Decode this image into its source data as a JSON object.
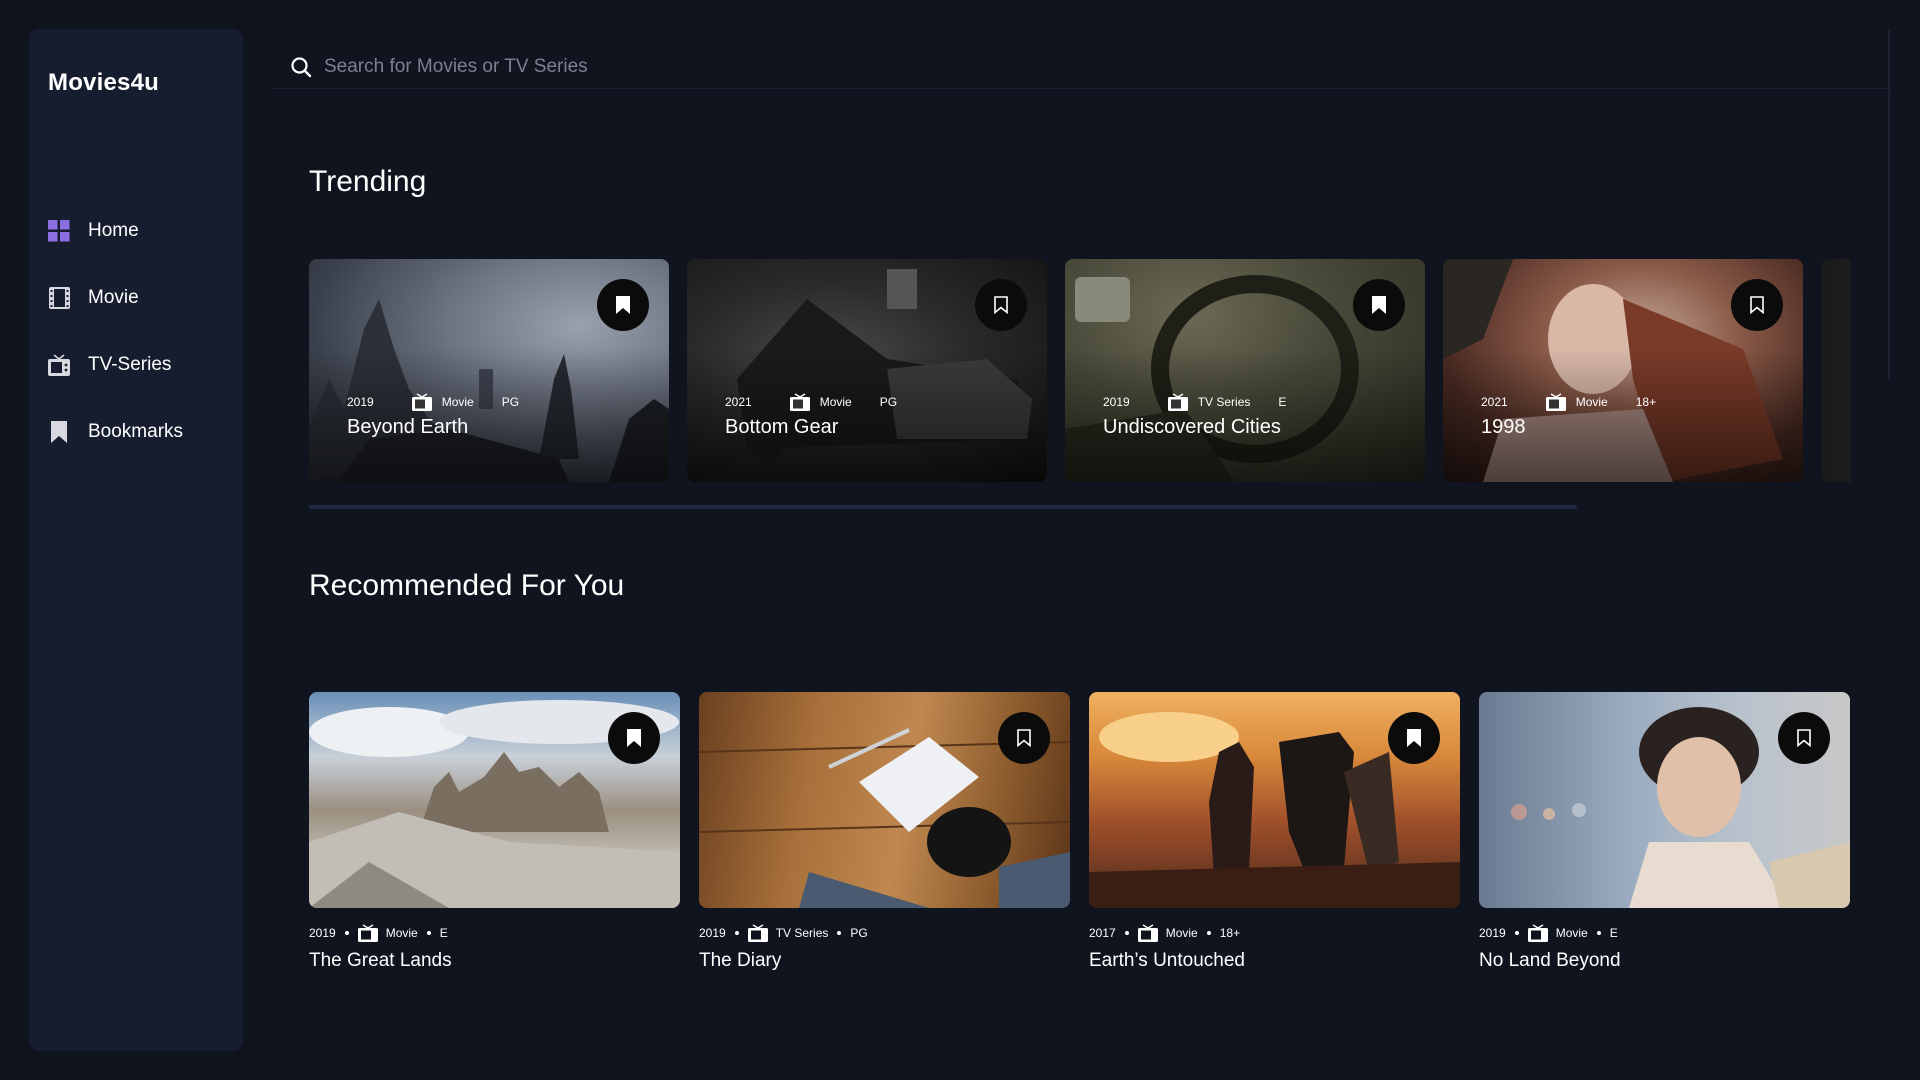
{
  "app": {
    "logo": "Movies4u"
  },
  "sidebar": {
    "items": [
      {
        "label": "Home",
        "icon": "grid-icon",
        "active": true
      },
      {
        "label": "Movie",
        "icon": "film-icon"
      },
      {
        "label": "TV-Series",
        "icon": "tv-icon"
      },
      {
        "label": "Bookmarks",
        "icon": "bookmark-icon"
      }
    ]
  },
  "search": {
    "placeholder": "Search for Movies or TV Series",
    "value": ""
  },
  "trending": {
    "title": "Trending",
    "items": [
      {
        "year": "2019",
        "category": "Movie",
        "rating": "PG",
        "title": "Beyond Earth"
      },
      {
        "year": "2021",
        "category": "Movie",
        "rating": "PG",
        "title": "Bottom Gear"
      },
      {
        "year": "2019",
        "category": "TV Series",
        "rating": "E",
        "title": "Undiscovered Cities"
      },
      {
        "year": "2021",
        "category": "Movie",
        "rating": "18+",
        "title": "1998"
      }
    ]
  },
  "recommended": {
    "title": "Recommended For You",
    "items": [
      {
        "year": "2019",
        "category": "Movie",
        "rating": "E",
        "title": "The Great Lands"
      },
      {
        "year": "2019",
        "category": "TV Series",
        "rating": "PG",
        "title": "The Diary"
      },
      {
        "year": "2017",
        "category": "Movie",
        "rating": "18+",
        "title": "Earth’s Untouched"
      },
      {
        "year": "2019",
        "category": "Movie",
        "rating": "E",
        "title": "No Land Beyond"
      }
    ]
  },
  "colors": {
    "background": "#10141e",
    "sidebar": "#161d2f",
    "accent": "#8b6ee0",
    "icon": "#d8d8e0"
  }
}
